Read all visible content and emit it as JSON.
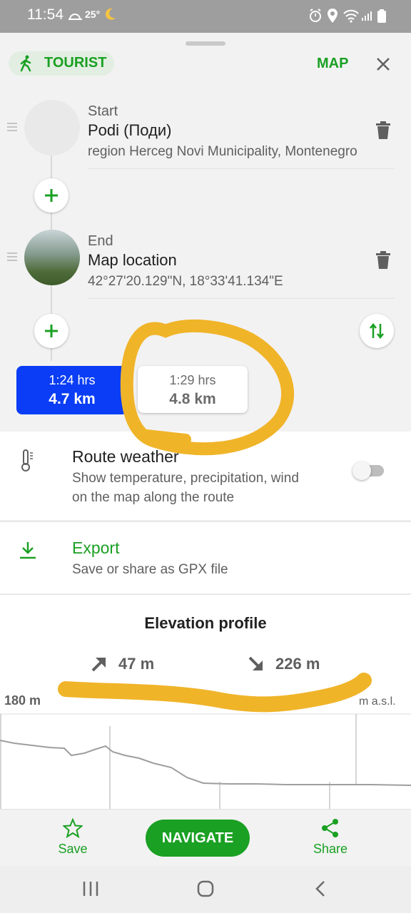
{
  "status_bar": {
    "time": "11:54",
    "temperature": "25°"
  },
  "header": {
    "mode_label": "TOURIST",
    "map_label": "MAP"
  },
  "waypoints": [
    {
      "label": "Start",
      "title": "Podi (Поди)",
      "subtitle": "region Herceg Novi Municipality, Montenegro"
    },
    {
      "label": "End",
      "title": "Map location",
      "subtitle": "42°27'20.129\"N, 18°33'41.134\"E"
    }
  ],
  "routes": [
    {
      "time": "1:24 hrs",
      "distance": "4.7 km",
      "selected": true
    },
    {
      "time": "1:29 hrs",
      "distance": "4.8 km",
      "selected": false
    }
  ],
  "route_weather": {
    "title": "Route weather",
    "subtitle_line1": "Show temperature, precipitation, wind",
    "subtitle_line2": "on the map along the route",
    "enabled": false
  },
  "export": {
    "title": "Export",
    "subtitle": "Save or share as GPX file"
  },
  "elevation": {
    "title": "Elevation profile",
    "ascent": "47 m",
    "descent": "226 m",
    "axis_top": "180 m",
    "axis_unit": "m a.s.l."
  },
  "bottom_bar": {
    "save_label": "Save",
    "navigate_label": "NAVIGATE",
    "share_label": "Share"
  },
  "colors": {
    "accent_green": "#1aa023",
    "selected_route_blue": "#0a3df5",
    "annotation_yellow": "#f0b429"
  }
}
